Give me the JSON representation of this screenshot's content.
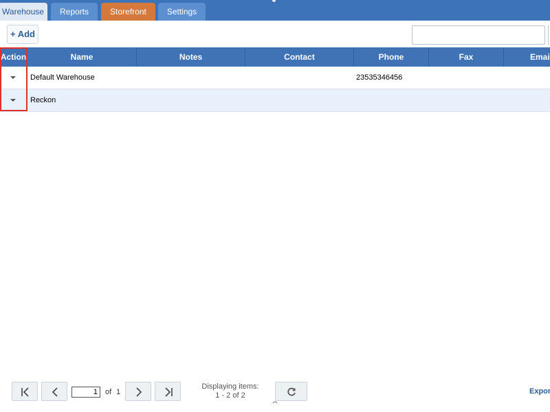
{
  "tabs": [
    {
      "label": "Warehouse",
      "active": true
    },
    {
      "label": "Reports",
      "active": false
    },
    {
      "label": "Storefront",
      "active": false,
      "color": "#d4783c"
    },
    {
      "label": "Settings",
      "active": false
    }
  ],
  "toolbar": {
    "add_label": "+ Add",
    "search_value": "",
    "search_placeholder": ""
  },
  "grid": {
    "columns": [
      "Action",
      "Name",
      "Notes",
      "Contact",
      "Phone",
      "Fax",
      "Email"
    ],
    "rows": [
      {
        "name": "Default Warehouse",
        "notes": "",
        "contact": "",
        "phone": "23535346456",
        "fax": "",
        "email": ""
      },
      {
        "name": "Reckon",
        "notes": "",
        "contact": "",
        "phone": "",
        "fax": "",
        "email": ""
      }
    ]
  },
  "pager": {
    "current_page": "1",
    "of_label": "of",
    "total_pages": "1",
    "display_label": "Displaying items:",
    "display_range": "1 - 2 of 2",
    "export_label": "Expor"
  },
  "icons": {
    "first": "first-page-icon",
    "prev": "prev-page-icon",
    "next": "next-page-icon",
    "last": "last-page-icon",
    "refresh": "refresh-icon",
    "row_action": "caret-down-icon"
  },
  "colors": {
    "tabbar": "#3d73b8",
    "header": "#3f73b6",
    "highlight": "#e0302e",
    "storefront_tab": "#d4783c",
    "alt_row": "#e8f0fb"
  }
}
